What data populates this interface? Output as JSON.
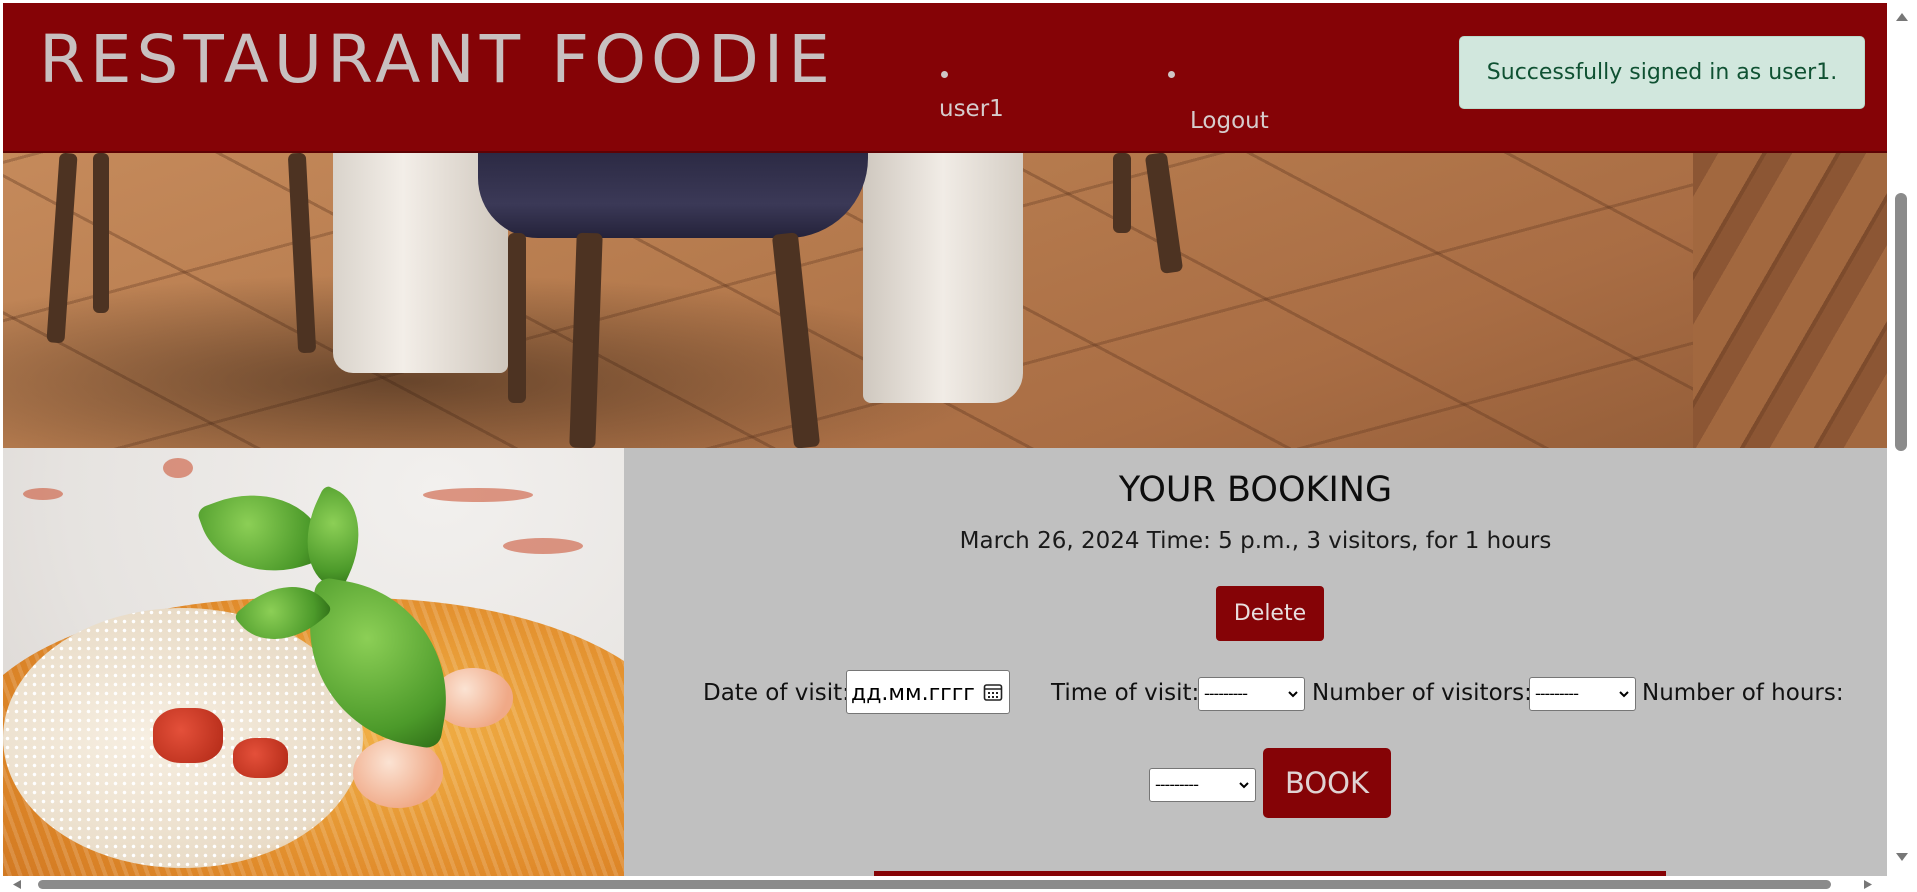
{
  "header": {
    "brand": "RESTAURANT FOODIE",
    "nav": [
      {
        "label": "user1"
      },
      {
        "label": "Logout"
      }
    ],
    "alert": "Successfully signed in as user1."
  },
  "booking": {
    "title": "YOUR BOOKING",
    "detail": "March 26, 2024 Time: 5 p.m., 3 visitors, for 1 hours",
    "delete_label": "Delete",
    "form": {
      "date_label": "Date of visit:",
      "date_placeholder": "дд.мм.гггг",
      "time_label": "Time of visit:",
      "time_value": "---------",
      "visitors_label": "Number of visitors:",
      "visitors_value": "---------",
      "hours_label": "Number of hours:",
      "hours_value": "---------",
      "book_label": "BOOK"
    }
  },
  "icons": {
    "calendar": "calendar-icon",
    "chevron": "chevron-down-icon"
  },
  "colors": {
    "brand_red": "#850306",
    "page_gray": "#c0c0c0",
    "alert_bg": "#d1e7dd",
    "alert_text": "#0f5132"
  }
}
